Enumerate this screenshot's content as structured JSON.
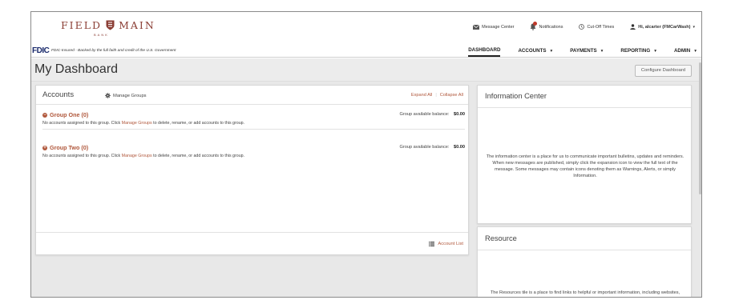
{
  "brand": {
    "name_left": "FIELD",
    "name_right": "MAIN",
    "sub": "BANK"
  },
  "utility_nav": {
    "message_center": "Message Center",
    "notifications": "Notifications",
    "cutoff": "Cut-Off Times",
    "user": "Hi, alcarter (FMCarWash)"
  },
  "fdic": {
    "logo": "FDIC",
    "text": "FDIC-Insured - Backed by the full faith and credit of the U.S. Government"
  },
  "main_nav": [
    {
      "label": "DASHBOARD",
      "active": true,
      "dropdown": false
    },
    {
      "label": "ACCOUNTS",
      "dropdown": true
    },
    {
      "label": "PAYMENTS",
      "dropdown": true
    },
    {
      "label": "REPORTING",
      "dropdown": true
    },
    {
      "label": "ADMIN",
      "dropdown": true
    }
  ],
  "page": {
    "title": "My Dashboard",
    "configure_label": "Configure Dashboard"
  },
  "accounts": {
    "title": "Accounts",
    "manage_label": "Manage Groups",
    "expand_label": "Expand All",
    "collapse_label": "Collapse All",
    "groups": [
      {
        "name": "Group One (0)",
        "balance_label": "Group available balance:",
        "balance": "$0.00",
        "note_pre": "No accounts assigned to this group. Click",
        "note_link": "Manage Groups",
        "note_post": "to delete, rename, or add accounts to this group."
      },
      {
        "name": "Group Two (0)",
        "balance_label": "Group available balance:",
        "balance": "$0.00",
        "note_pre": "No accounts assigned to this group. Click",
        "note_link": "Manage Groups",
        "note_post": "to delete, rename, or add accounts to this group."
      }
    ],
    "account_list_label": "Account List"
  },
  "info_center": {
    "title": "Information Center",
    "text": "The information center is a place for us to communicate important bulletins, updates and reminders. When new messages are published, simply click the expansion icon to view the full text of the message. Some messages may contain icons denoting them as Warnings, Alerts, or simply Information."
  },
  "resource": {
    "title": "Resource",
    "text": "The Resources tile is a place to find links to helpful or important information, including websites, forms and user guides. Check back soon for Resource"
  },
  "colors": {
    "accent": "#b0573b",
    "brand": "#8b3e35",
    "fdic": "#1a2a6c"
  }
}
